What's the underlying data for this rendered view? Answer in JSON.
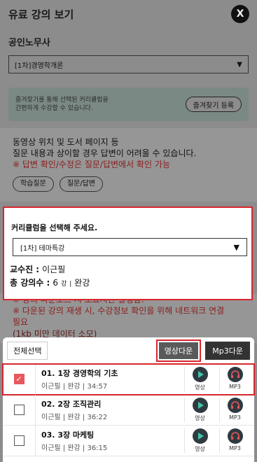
{
  "background": {
    "title": "유료 강의 보기",
    "close_label": "X",
    "section_title": "공인노무사",
    "select_value": "[1차]경영학개론",
    "tip_text_1": "즐겨찾기를 통해 선택된 커리큘럼을",
    "tip_text_2": "간편하게 수강할 수 있습니다.",
    "tip_button": "즐겨찾기 등록",
    "notice_1": "동영상 위치 및 도서 페이지 등",
    "notice_2": "질문 내용과 상이할 경우 답변이 어려울 수 있습니다.",
    "notice_red": "※ 답변 확인/수정은 질문/답변에서 확인 가능",
    "pill_1": "학습질문",
    "pill_2": "질문/답변",
    "lower_1": "※ 강의 다운로드 시 소요시간 발생함.",
    "lower_2": "※ 다운된 강의 재생 시, 수강정보 확인을 위해 네트워크 연결",
    "lower_3": "필요",
    "lower_4": "(1kb 미만 데이터 소모)"
  },
  "popup": {
    "title": "커리큘럼을 선택해 주세요.",
    "select_value": "[1차] 테마특강",
    "professor_label": "교수진 :",
    "professor_value": "이근필",
    "total_label": "총 강의수 :",
    "total_count": "6",
    "total_unit": "강",
    "total_status": "완강"
  },
  "sheet": {
    "select_all": "전체선택",
    "video_download": "영상다운",
    "mp3_download": "Mp3다운",
    "video_label": "영상",
    "mp3_label": "MP3",
    "lectures": [
      {
        "title": "01. 1장 경영학의 기초",
        "meta": "이근필 | 완강 | 34:57",
        "checked": true
      },
      {
        "title": "02. 2장 조직관리",
        "meta": "이근필 | 완강 | 36:22",
        "checked": false
      },
      {
        "title": "03. 3장 마케팅",
        "meta": "이근필 | 완강 | 36:15",
        "checked": false
      }
    ]
  },
  "colors": {
    "accent_red": "#d6262d",
    "check_on": "#e8585d",
    "overlay": "#8c8c8c",
    "icon_circle": "#2f3a40",
    "play_green": "#3fc4a8",
    "headphone_red": "#e8585d"
  }
}
